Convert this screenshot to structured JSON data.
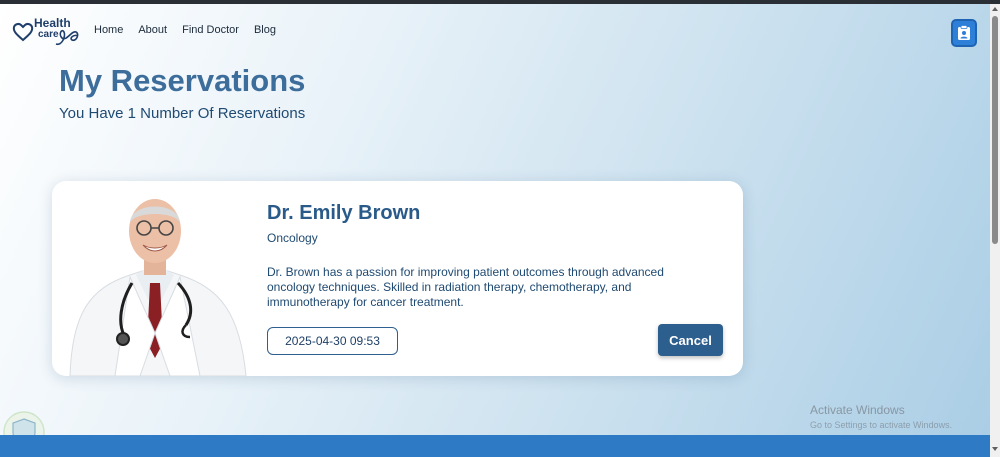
{
  "brand": {
    "logo_word1": "Health",
    "logo_word2": "care"
  },
  "nav": {
    "items": [
      {
        "label": "Home"
      },
      {
        "label": "About"
      },
      {
        "label": "Find Doctor"
      },
      {
        "label": "Blog"
      }
    ]
  },
  "header": {
    "profile_icon": "clipboard-user-icon"
  },
  "page": {
    "title": "My Reservations",
    "subtitle": "You Have 1 Number Of Reservations"
  },
  "reservations": [
    {
      "doctor_name": "Dr. Emily Brown",
      "specialty": "Oncology",
      "bio": "Dr. Brown has a passion for improving patient outcomes through advanced oncology techniques. Skilled in radiation therapy, chemotherapy, and immunotherapy for cancer treatment.",
      "datetime": "2025-04-30 09:53",
      "cancel_label": "Cancel"
    }
  ],
  "os_watermark": {
    "title": "Activate Windows",
    "subtitle": "Go to Settings to activate Windows."
  },
  "colors": {
    "accent": "#2d7fd8",
    "title": "#3d6e9b",
    "button": "#2d5f8e",
    "footer": "#2f7ac4"
  }
}
